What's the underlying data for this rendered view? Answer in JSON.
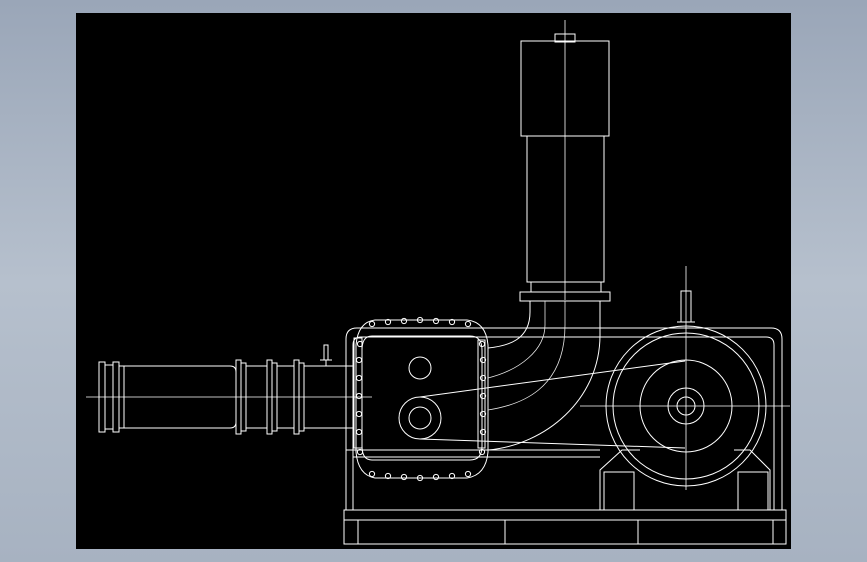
{
  "drawing": {
    "background": "#000000",
    "line_color": "#ffffff",
    "window_bg": "#a9b4c3",
    "subject": "roots-blower-unit-elevation"
  }
}
